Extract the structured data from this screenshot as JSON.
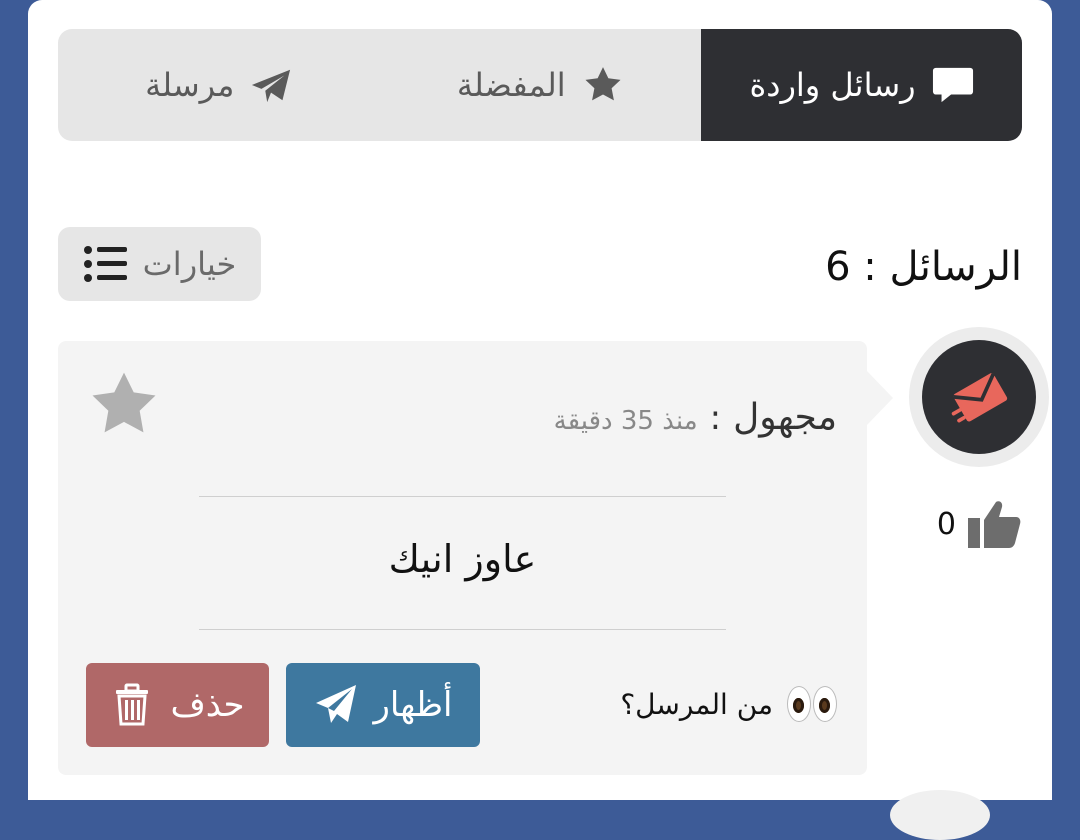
{
  "tabs": [
    {
      "label": "رسائل واردة",
      "icon": "comment-icon",
      "active": true
    },
    {
      "label": "المفضلة",
      "icon": "star-icon",
      "active": false
    },
    {
      "label": "مرسلة",
      "icon": "paper-plane-icon",
      "active": false
    }
  ],
  "messages_count": {
    "label": "الرسائل",
    "separator": ":",
    "value": "6"
  },
  "options": {
    "label": "خيارات",
    "icon": "list-icon"
  },
  "message": {
    "sender": "مجهول",
    "separator": ":",
    "time": "منذ 35 دقيقة",
    "text": "عاوز انيك",
    "likes": "0",
    "who_sent": "من المرسل؟",
    "show_label": "أظهار",
    "delete_label": "حذف"
  },
  "colors": {
    "background": "#3d5b97",
    "active_tab": "#2e2f33",
    "show_button": "#3e789f",
    "delete_button": "#b06868",
    "avatar_accent": "#e8675c"
  }
}
